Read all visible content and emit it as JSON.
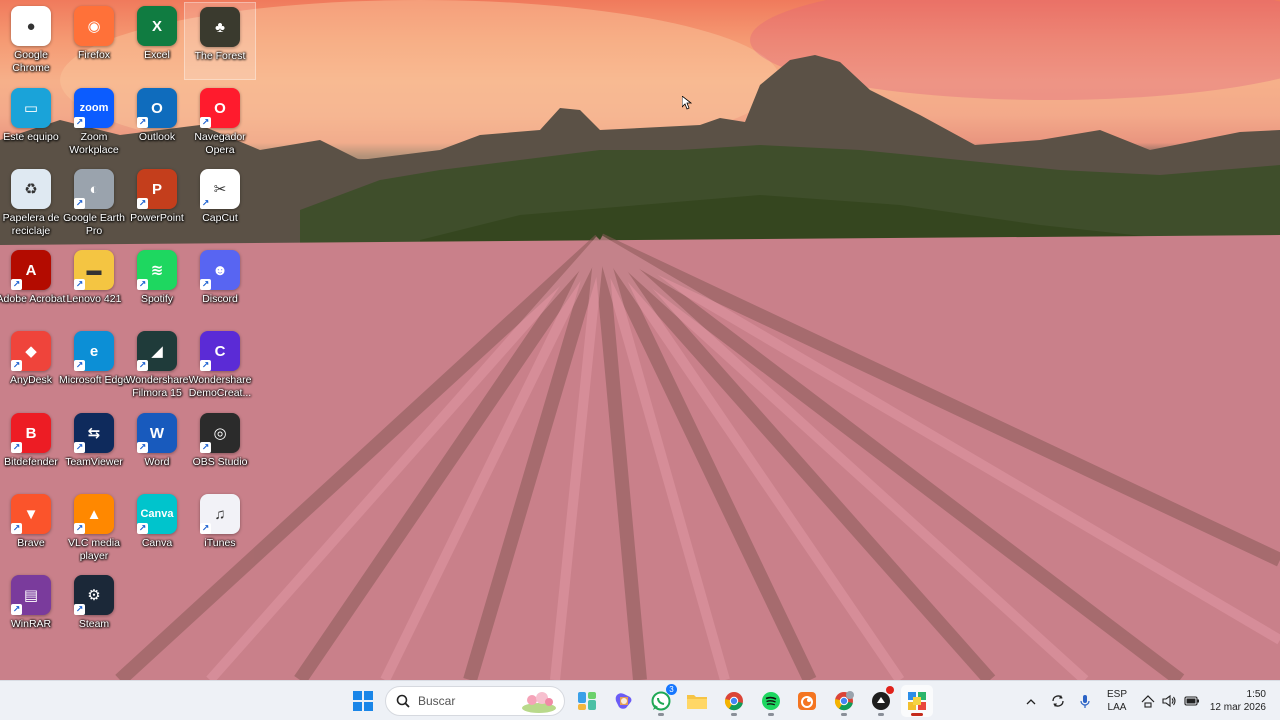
{
  "desktop": {
    "icons": [
      {
        "label": "Google Chrome",
        "icon": "chrome-icon",
        "color": "#ffffff"
      },
      {
        "label": "Firefox",
        "icon": "firefox-icon",
        "color": "#ff7139"
      },
      {
        "label": "Excel",
        "icon": "excel-icon",
        "color": "#107c41"
      },
      {
        "label": "The Forest",
        "icon": "the-forest-icon",
        "color": "#3a3a2e"
      },
      {
        "label": "Este equipo",
        "icon": "this-pc-icon",
        "color": "#1aa3d9"
      },
      {
        "label": "Zoom Workplace",
        "icon": "zoom-icon",
        "color": "#0b5cff"
      },
      {
        "label": "Outlook",
        "icon": "outlook-icon",
        "color": "#0f6cbd"
      },
      {
        "label": "Navegador Opera",
        "icon": "opera-icon",
        "color": "#ff1b2d"
      },
      {
        "label": "Papelera de reciclaje",
        "icon": "recycle-bin-icon",
        "color": "#dfe9f2"
      },
      {
        "label": "Google Earth Pro",
        "icon": "google-earth-icon",
        "color": "#9aa3ad"
      },
      {
        "label": "PowerPoint",
        "icon": "powerpoint-icon",
        "color": "#c43e1c"
      },
      {
        "label": "CapCut",
        "icon": "capcut-icon",
        "color": "#ffffff"
      },
      {
        "label": "Adobe Acrobat",
        "icon": "acrobat-icon",
        "color": "#b30b00"
      },
      {
        "label": "Lenovo 421",
        "icon": "folder-icon",
        "color": "#f4c542"
      },
      {
        "label": "Spotify",
        "icon": "spotify-icon",
        "color": "#1ed760"
      },
      {
        "label": "Discord",
        "icon": "discord-icon",
        "color": "#5865f2"
      },
      {
        "label": "AnyDesk",
        "icon": "anydesk-icon",
        "color": "#ef443b"
      },
      {
        "label": "Microsoft Edge",
        "icon": "edge-icon",
        "color": "#0c8fd6"
      },
      {
        "label": "Wondershare Filmora 15",
        "icon": "filmora-icon",
        "color": "#1f3b3a"
      },
      {
        "label": "Wondershare DemoCreat...",
        "icon": "democreator-icon",
        "color": "#5b2bd6"
      },
      {
        "label": "Bitdefender",
        "icon": "bitdefender-icon",
        "color": "#ed1c24"
      },
      {
        "label": "TeamViewer",
        "icon": "teamviewer-icon",
        "color": "#0e2a5c"
      },
      {
        "label": "Word",
        "icon": "word-icon",
        "color": "#185abd"
      },
      {
        "label": "OBS Studio",
        "icon": "obs-icon",
        "color": "#2b2b2b"
      },
      {
        "label": "Brave",
        "icon": "brave-icon",
        "color": "#fb542b"
      },
      {
        "label": "VLC media player",
        "icon": "vlc-icon",
        "color": "#ff8800"
      },
      {
        "label": "Canva",
        "icon": "canva-icon",
        "color": "#00c4cc"
      },
      {
        "label": "iTunes",
        "icon": "itunes-icon",
        "color": "#f2f2f7"
      },
      {
        "label": "WinRAR",
        "icon": "winrar-icon",
        "color": "#7a3b9c"
      },
      {
        "label": "Steam",
        "icon": "steam-icon",
        "color": "#1b2838"
      }
    ]
  },
  "taskbar": {
    "search_placeholder": "Buscar",
    "pinned": [
      {
        "name": "start-button",
        "icon": "windows-icon"
      },
      {
        "name": "widgets-button",
        "icon": "widgets-icon"
      },
      {
        "name": "copilot-button",
        "icon": "copilot-icon"
      },
      {
        "name": "whatsapp-button",
        "icon": "whatsapp-icon",
        "badge": "3"
      },
      {
        "name": "file-explorer-button",
        "icon": "folder-icon"
      },
      {
        "name": "chrome-button",
        "icon": "chrome-icon"
      },
      {
        "name": "spotify-button",
        "icon": "spotify-icon"
      },
      {
        "name": "crunchyroll-button",
        "icon": "orange-app-icon"
      },
      {
        "name": "chrome-profile-button",
        "icon": "chrome-icon"
      },
      {
        "name": "app-button",
        "icon": "dark-app-icon"
      },
      {
        "name": "active-app-button",
        "icon": "windows-tiles-icon"
      }
    ],
    "tray": {
      "language_top": "ESP",
      "language_bottom": "LAA",
      "time": "1:50",
      "date": "12 mar 2026"
    }
  }
}
